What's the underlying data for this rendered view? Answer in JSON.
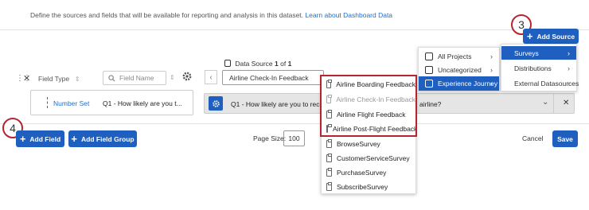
{
  "intro": {
    "text": "Define the sources and fields that will be available for reporting and analysis in this dataset.",
    "link": "Learn about Dashboard Data"
  },
  "callouts": {
    "step3": "3",
    "step4": "4"
  },
  "toolbar": {
    "add_source": "Add Source",
    "field_type": "Field Type",
    "field_name_placeholder": "Field Name",
    "data_source_label": "Data Source",
    "data_source_current": "1",
    "data_source_of": "of",
    "data_source_total": "1",
    "data_source_selected": "Airline Check-In Feedback"
  },
  "field_row": {
    "type": "Number Set",
    "name": "Q1 - How likely are you t...",
    "mapping_prefix": "Q1 - How likely are you to recomm",
    "mapping_suffix": "airline?"
  },
  "source_menu": {
    "items": [
      {
        "label": "All Projects",
        "icon": "list-icon"
      },
      {
        "label": "Uncategorized",
        "icon": "folder-icon"
      },
      {
        "label": "Experience Journey",
        "icon": "folder-icon"
      }
    ]
  },
  "type_menu": {
    "items": [
      {
        "label": "Surveys"
      },
      {
        "label": "Distributions"
      },
      {
        "label": "External Datasources"
      }
    ]
  },
  "surveys": {
    "items": [
      {
        "label": "Airline Boarding Feedback",
        "disabled": false
      },
      {
        "label": "Airline Check-In Feedback",
        "disabled": true
      },
      {
        "label": "Airline Flight Feedback",
        "disabled": false
      },
      {
        "label": "Airline Post-Flight Feedback",
        "disabled": false
      },
      {
        "label": "BrowseSurvey",
        "disabled": false
      },
      {
        "label": "CustomerServiceSurvey",
        "disabled": false
      },
      {
        "label": "PurchaseSurvey",
        "disabled": false
      },
      {
        "label": "SubscribeSurvey",
        "disabled": false
      }
    ]
  },
  "footer": {
    "add_field": "Add Field",
    "add_field_group": "Add Field Group",
    "page_size_label": "Page Size:",
    "page_size_value": "100",
    "cancel": "Cancel",
    "save": "Save"
  },
  "colors": {
    "primary": "#1f5fbf",
    "callout": "#b5242f"
  }
}
